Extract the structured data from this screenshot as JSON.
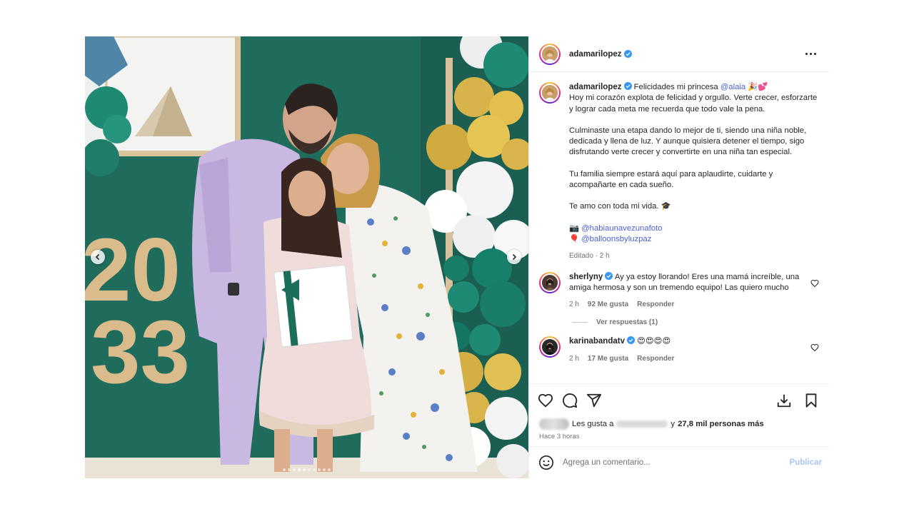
{
  "post": {
    "username": "adamarilopez",
    "verified": true
  },
  "media": {
    "big_text_line1": "20",
    "big_text_line2": "33",
    "slide_count": 10,
    "active_slide": 3
  },
  "caption": {
    "username": "adamarilopez",
    "line1_text": "Felicidades mi princesa ",
    "mention": "@alaia",
    "line1_emoji": " 🎉💕",
    "para1": "Hoy mi corazón explota de felicidad y orgullo. Verte crecer, esforzarte y lograr cada meta me recuerda que todo vale la pena.",
    "para2": "Culminaste una etapa dando lo mejor de ti, siendo una niña noble, dedicada y llena de luz. Y aunque quisiera detener el tiempo, sigo disfrutando verte crecer y convertirte en una niña tan especial.",
    "para3": "Tu familia siempre estará aquí para aplaudirte, cuidarte y acompañarte en cada sueño.",
    "para4": "Te amo con toda mi vida. 🎓",
    "credit1_icon": "📷",
    "credit1": "@habiaunavezunafoto",
    "credit2_icon": "🎈",
    "credit2": "@balloonsbyluzpaz",
    "edited": "Editado · 2 h"
  },
  "comments": [
    {
      "username": "sherlyny",
      "text": "Ay ya estoy llorando! Eres una mamá increíble, una amiga hermosa y son un tremendo equipo! Las quiero mucho",
      "time": "2 h",
      "likes": "92 Me gusta",
      "reply": "Responder",
      "view_replies": "Ver respuestas (1)"
    },
    {
      "username": "karinabandatv",
      "text": "😍😍😍😍",
      "time": "2 h",
      "likes": "17 Me gusta",
      "reply": "Responder"
    }
  ],
  "likes_line": {
    "prefix": "Les gusta a",
    "connector": "y",
    "count": "27,8 mil personas más"
  },
  "time_ago": "Hace 3 horas",
  "add_comment": {
    "placeholder": "Agrega un comentario...",
    "publish": "Publicar"
  },
  "colors": {
    "mention": "#4a5fd6",
    "publish_disabled": "#a8c7f5",
    "backdrop_green": "#1f6b5c"
  }
}
